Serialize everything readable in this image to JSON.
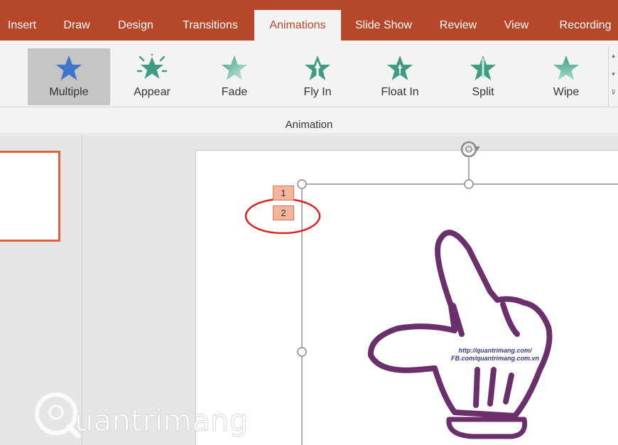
{
  "tabs": [
    {
      "label": "Insert"
    },
    {
      "label": "Draw"
    },
    {
      "label": "Design"
    },
    {
      "label": "Transitions"
    },
    {
      "label": "Animations"
    },
    {
      "label": "Slide Show"
    },
    {
      "label": "Review"
    },
    {
      "label": "View"
    },
    {
      "label": "Recording"
    }
  ],
  "gallery": [
    {
      "label": "Multiple",
      "icon": "star-icon",
      "color": "#3f76c7"
    },
    {
      "label": "Appear",
      "icon": "appear-star-icon",
      "color": "#3f9c84"
    },
    {
      "label": "Fade",
      "icon": "fade-star-icon",
      "color": "#8fd0bf"
    },
    {
      "label": "Fly In",
      "icon": "fly-in-star-icon",
      "color": "#3f9c84"
    },
    {
      "label": "Float In",
      "icon": "float-in-star-icon",
      "color": "#3f9c84"
    },
    {
      "label": "Split",
      "icon": "split-star-icon",
      "color": "#3f9c84"
    },
    {
      "label": "Wipe",
      "icon": "wipe-star-icon",
      "color": "#7ac4ae"
    }
  ],
  "group_label": "Animation",
  "slide": {
    "anim_tags": [
      "1",
      "2"
    ],
    "hand_text_line1": "http://quantrimang.com/",
    "hand_text_line2": "FB.com/quantrimang.com.vn"
  },
  "watermark": {
    "text": "uantrimang"
  },
  "colors": {
    "accent": "#b7472a",
    "outline": "#6b2f6b",
    "highlight": "#e02020"
  }
}
